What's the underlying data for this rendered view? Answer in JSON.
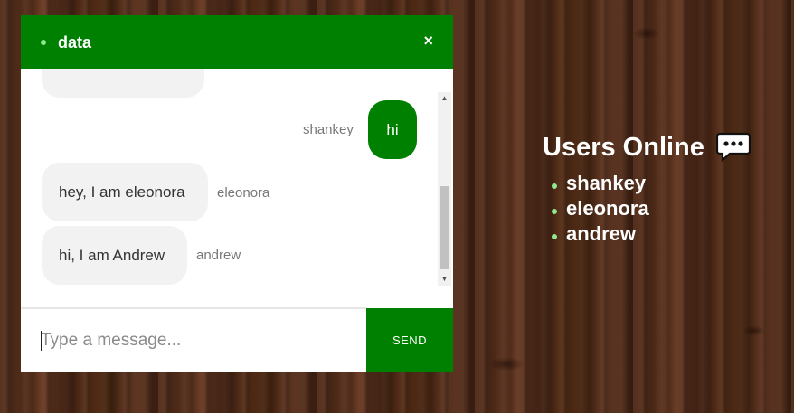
{
  "chat": {
    "title": "data",
    "close_label": "×",
    "messages": [
      {
        "direction": "out",
        "sender": "shankey",
        "text": "hi"
      },
      {
        "direction": "in",
        "sender": "eleonora",
        "text": "hey, I am eleonora"
      },
      {
        "direction": "in",
        "sender": "andrew",
        "text": "hi, I am Andrew"
      }
    ],
    "input": {
      "placeholder": "Type a message...",
      "value": ""
    },
    "send_label": "SEND"
  },
  "users_online": {
    "title": "Users Online",
    "icon": "chat-bubble-icon",
    "users": [
      "shankey",
      "eleonora",
      "andrew"
    ]
  },
  "colors": {
    "accent": "#008000",
    "status_dot": "#8fe88f",
    "incoming_bubble": "#f2f2f2"
  }
}
